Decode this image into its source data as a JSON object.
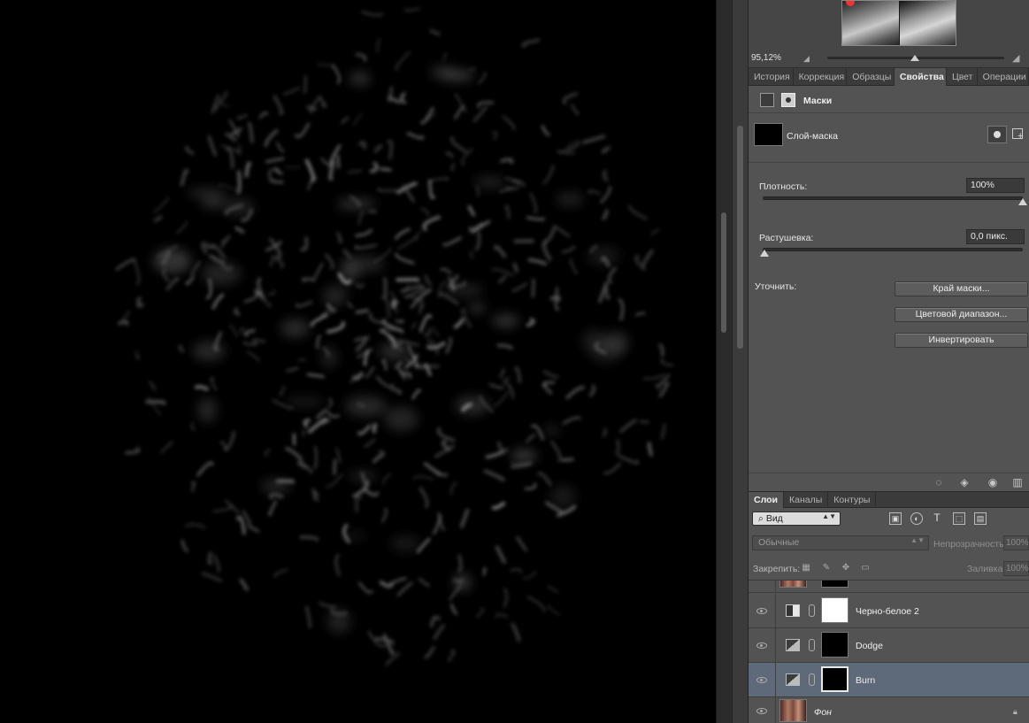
{
  "navigator": {
    "zoom": "95,12%"
  },
  "properties_tabs": [
    {
      "label": "История",
      "active": false
    },
    {
      "label": "Коррекция",
      "active": false
    },
    {
      "label": "Образцы",
      "active": false
    },
    {
      "label": "Свойства",
      "active": true
    },
    {
      "label": "Цвет",
      "active": false
    },
    {
      "label": "Операции",
      "active": false
    }
  ],
  "properties": {
    "title": "Маски",
    "mask_label": "Слой-маска",
    "density_label": "Плотность:",
    "density_value": "100%",
    "density_level": 1.0,
    "feather_label": "Растушевка:",
    "feather_value": "0,0 пикс.",
    "feather_level": 0.0,
    "refine_label": "Уточнить:",
    "mask_edge_btn": "Край маски...",
    "color_range_btn": "Цветовой диапазон...",
    "invert_btn": "Инвертировать"
  },
  "layers_tabs": [
    {
      "label": "Слои",
      "active": true
    },
    {
      "label": "Каналы",
      "active": false
    },
    {
      "label": "Контуры",
      "active": false
    }
  ],
  "layers_panel": {
    "kind_filter": "Вид",
    "blend_mode": "Обычные",
    "opacity_label": "Непрозрачность:",
    "opacity_value": "100%",
    "lock_label": "Закрепить:",
    "fill_label": "Заливка:",
    "fill_value": "100%"
  },
  "layers": [
    {
      "name": "Черно-белое 2",
      "type": "black-white",
      "mask": "white",
      "selected": false
    },
    {
      "name": "Dodge",
      "type": "curves",
      "mask": "black",
      "selected": false
    },
    {
      "name": "Burn",
      "type": "curves",
      "mask": "black",
      "selected": true
    },
    {
      "name": "Фон",
      "type": "background",
      "mask": "none",
      "selected": false
    }
  ],
  "colors": {
    "panel_bg": "#535353",
    "selected_layer": "#5e6a7a",
    "canvas_bg": "#000000"
  }
}
